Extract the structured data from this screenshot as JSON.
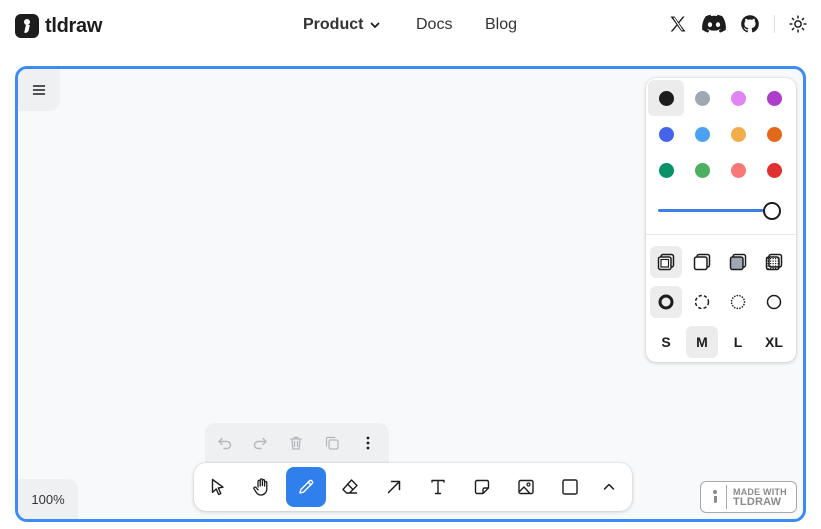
{
  "nav": {
    "brand": "tldraw",
    "product": "Product",
    "docs": "Docs",
    "blog": "Blog"
  },
  "canvas": {
    "zoom": "100%"
  },
  "style_panel": {
    "colors": [
      "#1d1d1d",
      "#9fa8b2",
      "#e085f4",
      "#ae3ec9",
      "#4465e9",
      "#4ba1f1",
      "#f1ac4b",
      "#e16919",
      "#099268",
      "#4cb05e",
      "#f87777",
      "#e03131"
    ],
    "selected_color": "#1d1d1d",
    "opacity": 1.0,
    "sizes": [
      "S",
      "M",
      "L",
      "XL"
    ],
    "selected_size": "M"
  },
  "badge": {
    "line1": "MADE WITH",
    "line2": "TLDRAW"
  },
  "theme": {
    "accent": "#3d8cf5",
    "active_tool": "#2f80ed"
  }
}
